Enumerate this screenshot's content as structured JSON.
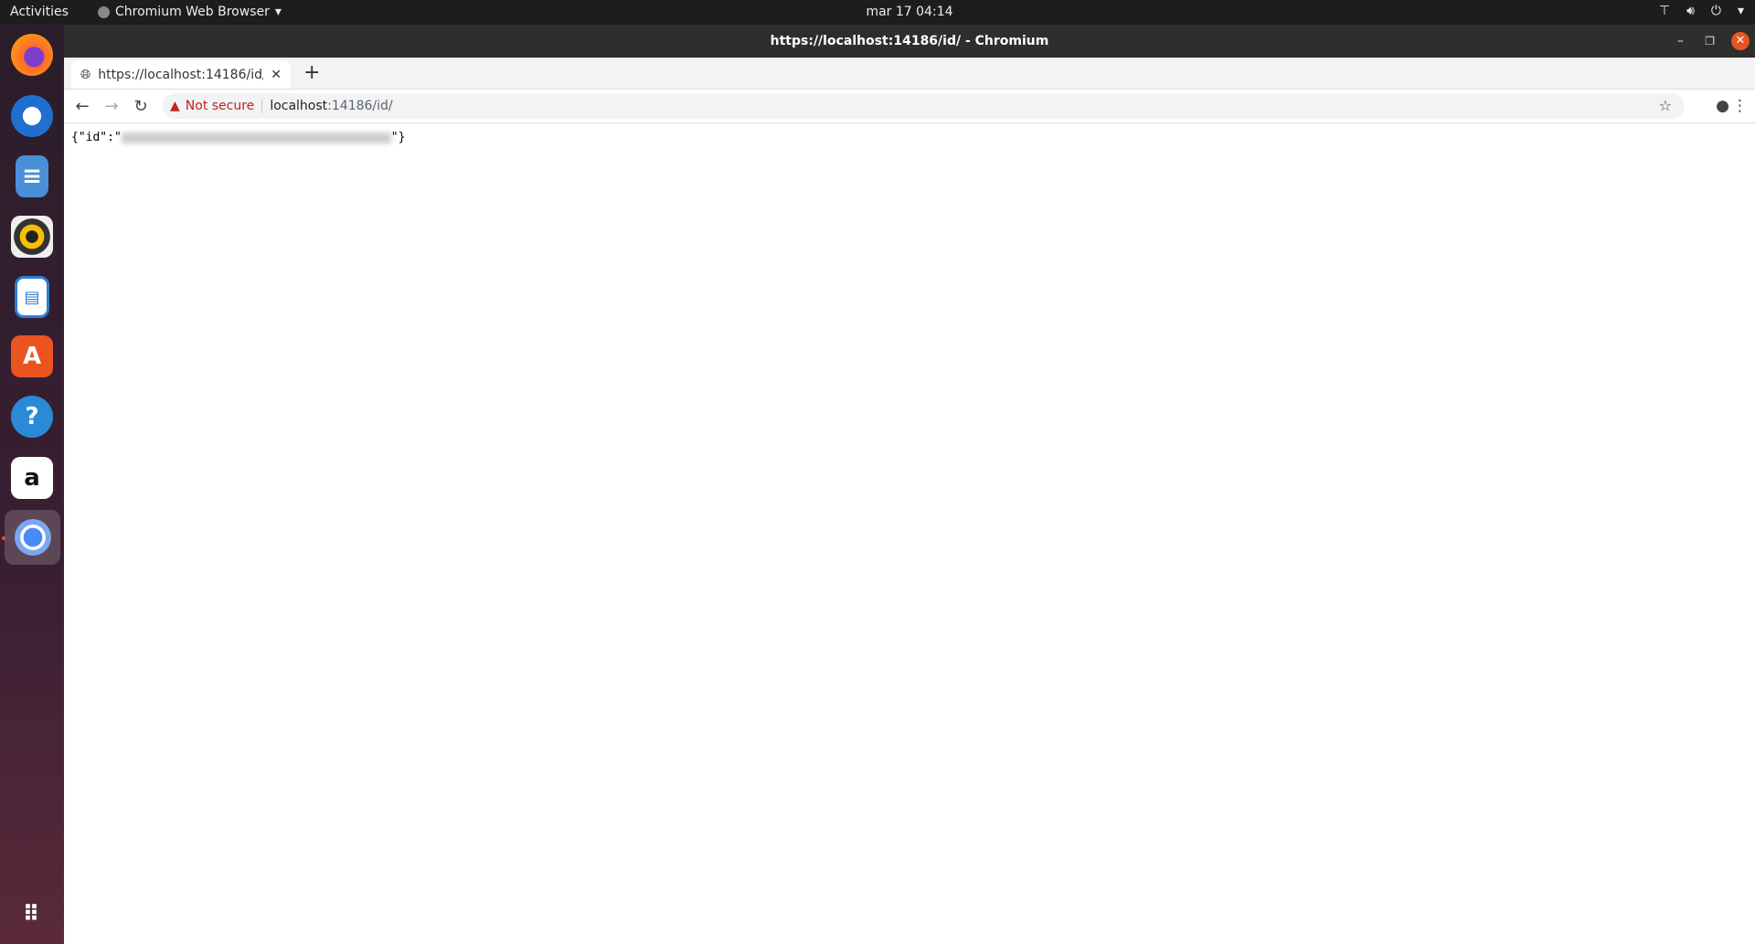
{
  "topbar": {
    "activities": "Activities",
    "app_name": "Chromium Web Browser",
    "clock": "mar 17  04:14"
  },
  "dock": {
    "items": [
      "firefox",
      "thunderbird",
      "files",
      "rhythmbox",
      "libreoffice-writer",
      "ubuntu-software",
      "help",
      "amazon",
      "chromium"
    ],
    "active": "chromium"
  },
  "window": {
    "title": "https://localhost:14186/id/ - Chromium"
  },
  "tab": {
    "title": "https://localhost:14186/id/"
  },
  "omnibox": {
    "security": "Not secure",
    "host": "localhost",
    "path": ":14186/id/"
  },
  "content": {
    "prefix": "{\"id\":\"",
    "suffix": "\"}",
    "value_redacted": true
  },
  "colors": {
    "close": "#e95420",
    "warning": "#c5221f"
  }
}
